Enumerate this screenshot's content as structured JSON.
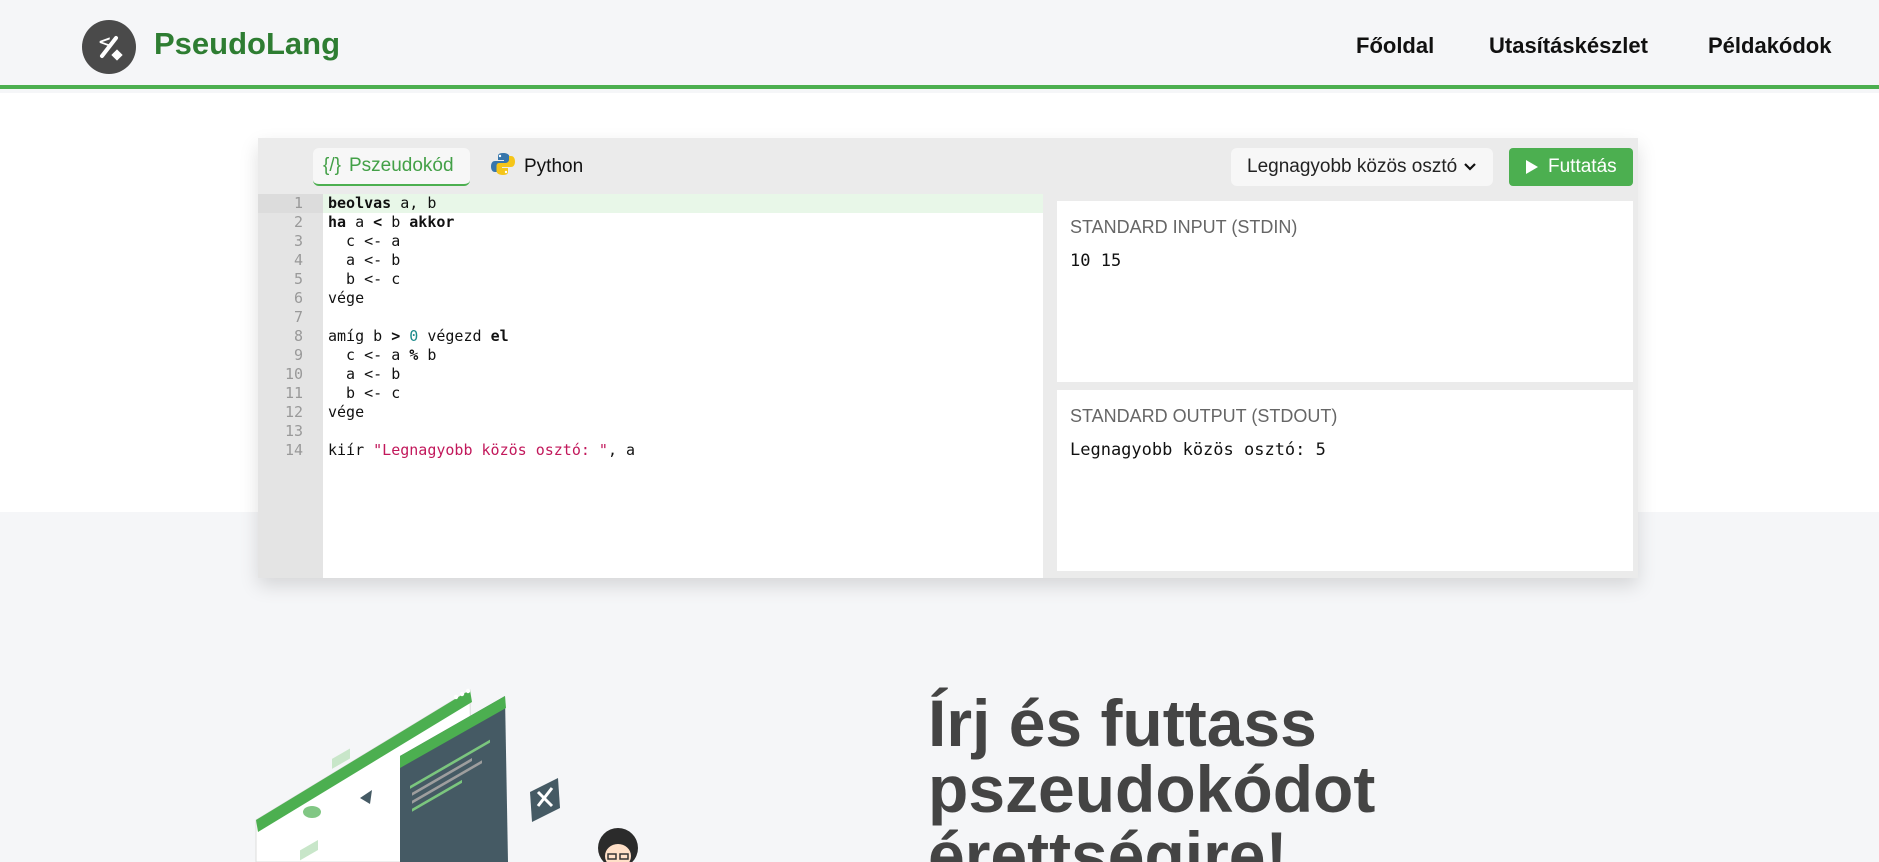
{
  "header": {
    "brand": "PseudoLang",
    "nav": [
      "Főoldal",
      "Utasításkészlet",
      "Példakódok"
    ]
  },
  "editor": {
    "tabs": [
      {
        "label": "Pszeudokód",
        "icon": "code-brackets-icon",
        "active": true
      },
      {
        "label": "Python",
        "icon": "python-icon",
        "active": false
      }
    ],
    "example_select": "Legnagyobb közös osztó",
    "run_label": "Futtatás",
    "line_numbers": [
      "1",
      "2",
      "3",
      "4",
      "5",
      "6",
      "7",
      "8",
      "9",
      "10",
      "11",
      "12",
      "13",
      "14"
    ],
    "code": [
      "beolvas a, b",
      "ha a < b akkor",
      "  c <- a",
      "  a <- b",
      "  b <- c",
      "vége",
      "",
      "amíg b > 0 végezd el",
      "  c <- a % b",
      "  a <- b",
      "  b <- c",
      "vége",
      "",
      "kiír \"Legnagyobb közös osztó: \", a"
    ]
  },
  "stdin": {
    "label": "STANDARD INPUT (STDIN)",
    "value": "10 15"
  },
  "stdout": {
    "label": "STANDARD OUTPUT (STDOUT)",
    "value": "Legnagyobb közös osztó: 5"
  },
  "hero": {
    "title_lines": [
      "Írj és futtass",
      "pszeudokódot",
      "érettségire!"
    ]
  },
  "colors": {
    "accent": "#4caf50",
    "brand": "#2e7d32"
  }
}
